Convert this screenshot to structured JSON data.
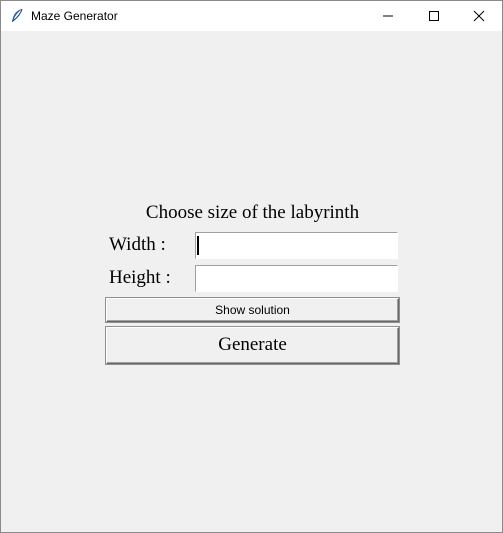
{
  "window": {
    "title": "Maze Generator",
    "controls": [
      "minimize-icon",
      "maximize-icon",
      "close-icon"
    ]
  },
  "form": {
    "heading": "Choose size of the labyrinth",
    "width_label": "Width :",
    "width_value": "",
    "height_label": "Height :",
    "height_value": "",
    "show_solution_label": "Show solution",
    "generate_label": "Generate"
  },
  "colors": {
    "background": "#f0f0f0",
    "titlebar": "#ffffff",
    "app_icon": "#1f5fa8"
  }
}
